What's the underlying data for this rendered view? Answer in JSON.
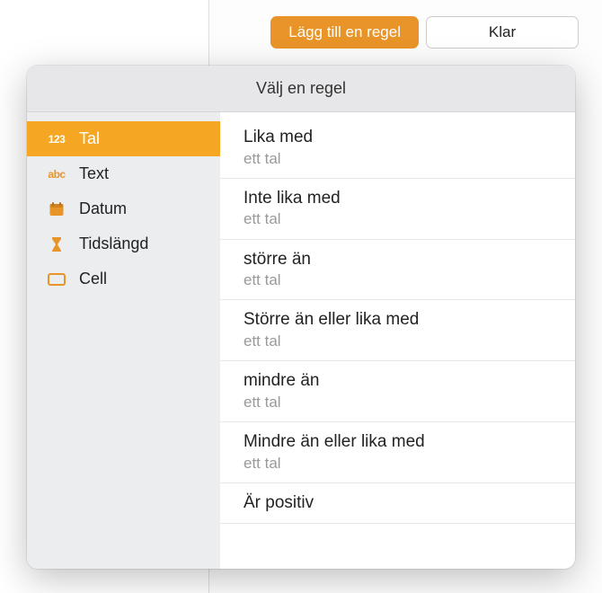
{
  "toolbar": {
    "add_rule_label": "Lägg till en regel",
    "done_label": "Klar"
  },
  "popover": {
    "title": "Välj en regel"
  },
  "sidebar": {
    "items": [
      {
        "icon": "123",
        "label": "Tal",
        "selected": true
      },
      {
        "icon": "abc",
        "label": "Text",
        "selected": false
      },
      {
        "icon": "calendar",
        "label": "Datum",
        "selected": false
      },
      {
        "icon": "hourglass",
        "label": "Tidslängd",
        "selected": false
      },
      {
        "icon": "cell",
        "label": "Cell",
        "selected": false
      }
    ]
  },
  "rules": [
    {
      "title": "Lika med",
      "sub": "ett tal"
    },
    {
      "title": "Inte lika med",
      "sub": "ett tal"
    },
    {
      "title": "större än",
      "sub": "ett tal"
    },
    {
      "title": "Större än eller lika med",
      "sub": "ett tal"
    },
    {
      "title": "mindre än",
      "sub": "ett tal"
    },
    {
      "title": "Mindre än eller lika med",
      "sub": "ett tal"
    },
    {
      "title": "Är positiv",
      "sub": ""
    }
  ]
}
